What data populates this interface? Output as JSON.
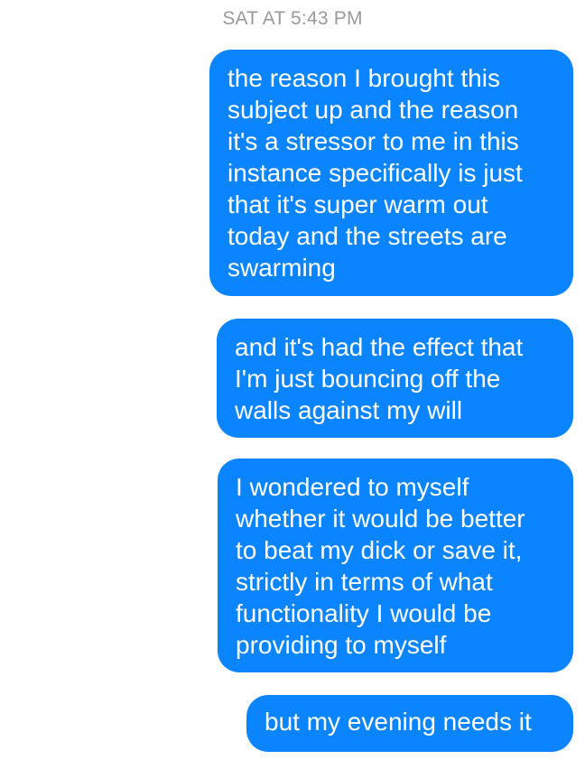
{
  "conversation": {
    "timestamp": "SAT AT 5:43 PM",
    "messages": [
      {
        "sender": "me",
        "text": "the reason I brought this\nsubject up and the reason\nit's a stressor to me in this\ninstance specifically is just\nthat it's super warm out\ntoday and the streets are\nswarming"
      },
      {
        "sender": "me",
        "text": "and it's had the effect that\nI'm just bouncing off the\nwalls against my will"
      },
      {
        "sender": "me",
        "text": "I wondered to myself\nwhether it would be better\nto beat my dick or save it,\nstrictly in terms of what\nfunctionality I would be\nproviding to myself"
      },
      {
        "sender": "me",
        "text": "but my evening needs it"
      }
    ]
  },
  "colors": {
    "outgoing_bubble": "#0a84ff",
    "outgoing_text": "#ffffff",
    "timestamp_text": "#9a9a9a",
    "background": "#ffffff"
  }
}
